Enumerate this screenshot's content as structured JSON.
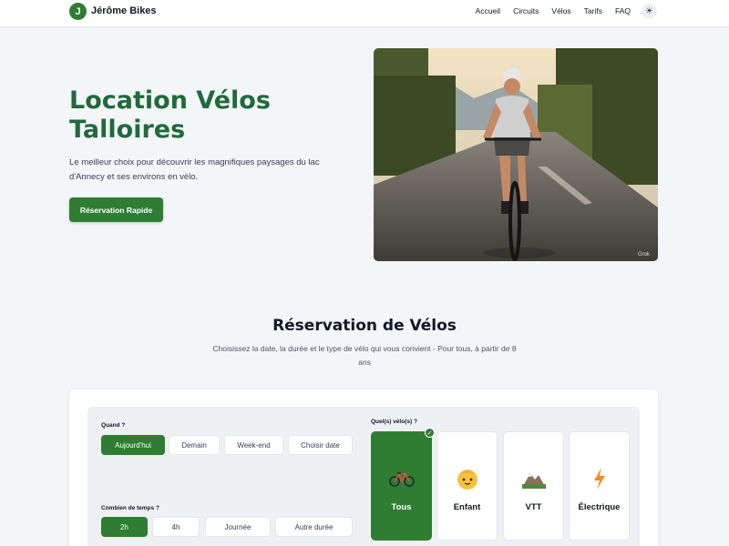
{
  "header": {
    "logo_letter": "J",
    "brand": "Jérôme Bikes",
    "nav": [
      "Accueil",
      "Circuits",
      "Vélos",
      "Tarifs",
      "FAQ"
    ],
    "theme_icon": "sun-icon"
  },
  "hero": {
    "title_line1": "Location Vélos",
    "title_line2": "Talloires",
    "description": "Le meilleur choix pour découvrir les magnifiques paysages du lac d'Annecy et ses environs en vélo.",
    "cta": "Réservation Rapide",
    "photo_watermark": "Grok"
  },
  "booking": {
    "title": "Réservation de Vélos",
    "subtitle": "Choisissez la date, la durée et le type de vélo qui vous convient - Pour tous, à partir de 8 ans",
    "when_label": "Quand ?",
    "when_options": [
      "Aujourd'hui",
      "Demain",
      "Week-end",
      "Choisir date"
    ],
    "when_selected": "Aujourd'hui",
    "duration_label": "Combien de temps ?",
    "duration_options": [
      "2h",
      "4h",
      "Journée",
      "Autre durée"
    ],
    "duration_selected": "2h",
    "bikes_label": "Quel(s) vélo(s) ?",
    "bikes": [
      {
        "label": "Tous",
        "icon": "bicycle-icon",
        "selected": true
      },
      {
        "label": "Enfant",
        "icon": "child-face-icon",
        "selected": false
      },
      {
        "label": "VTT",
        "icon": "mountain-icon",
        "selected": false
      },
      {
        "label": "Électrique",
        "icon": "lightning-icon",
        "selected": false
      }
    ]
  },
  "colors": {
    "accent": "#2e7d32",
    "title_green": "#1f6b3a",
    "background": "#f4f5f9"
  }
}
